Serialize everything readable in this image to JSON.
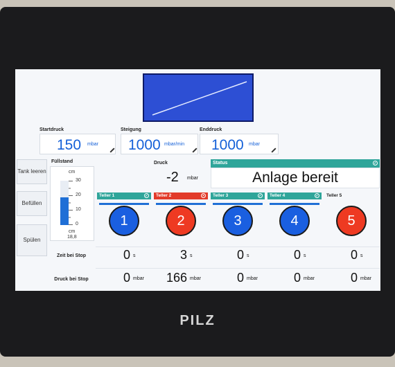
{
  "device": {
    "brand": "PILZ"
  },
  "params": {
    "start": {
      "label": "Startdruck",
      "value": "150",
      "unit": "mbar"
    },
    "slope": {
      "label": "Steigung",
      "value": "1000",
      "unit": "mbar/min"
    },
    "end": {
      "label": "Enddruck",
      "value": "1000",
      "unit": "mbar"
    }
  },
  "sidebar": [
    {
      "label": "Tank leeren"
    },
    {
      "label": "Befüllen"
    },
    {
      "label": "Spülen"
    }
  ],
  "fuellstand": {
    "label": "Füllstand",
    "unit": "cm",
    "ticks": [
      "30",
      "20",
      "10",
      "0"
    ],
    "value": "18,8",
    "value_unit": "cm",
    "level_fraction": 0.627,
    "max": 30
  },
  "druck": {
    "label": "Druck",
    "value": "-2",
    "unit": "mbar"
  },
  "status": {
    "label": "Status",
    "text": "Anlage bereit",
    "color": "#2fa59a"
  },
  "plates": [
    {
      "label": "Teller 1",
      "number": "1",
      "state": "ok",
      "header_color": "#2fa59a",
      "circle_color": "#1a5fe0",
      "time": "0",
      "pressure": "0"
    },
    {
      "label": "Teller 2",
      "number": "2",
      "state": "error",
      "header_color": "#e23b2a",
      "circle_color": "#ee3a22",
      "time": "3",
      "pressure": "166"
    },
    {
      "label": "Teller 3",
      "number": "3",
      "state": "ok",
      "header_color": "#2fa59a",
      "circle_color": "#1a5fe0",
      "time": "0",
      "pressure": "0"
    },
    {
      "label": "Teller 4",
      "number": "4",
      "state": "ok",
      "header_color": "#2fa59a",
      "circle_color": "#1a5fe0",
      "time": "0",
      "pressure": "0"
    },
    {
      "label": "Teller 5",
      "number": "5",
      "state": "none",
      "header_color": "",
      "circle_color": "#ee3a22",
      "time": "0",
      "pressure": "0"
    }
  ],
  "rows": {
    "time": {
      "label": "Zeit bei Stop",
      "unit": "s"
    },
    "pressure": {
      "label": "Druck bei Stop",
      "unit": "mbar"
    }
  },
  "colors": {
    "accent_blue": "#1a5fe0",
    "accent_red": "#ee3a22",
    "teal": "#2fa59a"
  }
}
